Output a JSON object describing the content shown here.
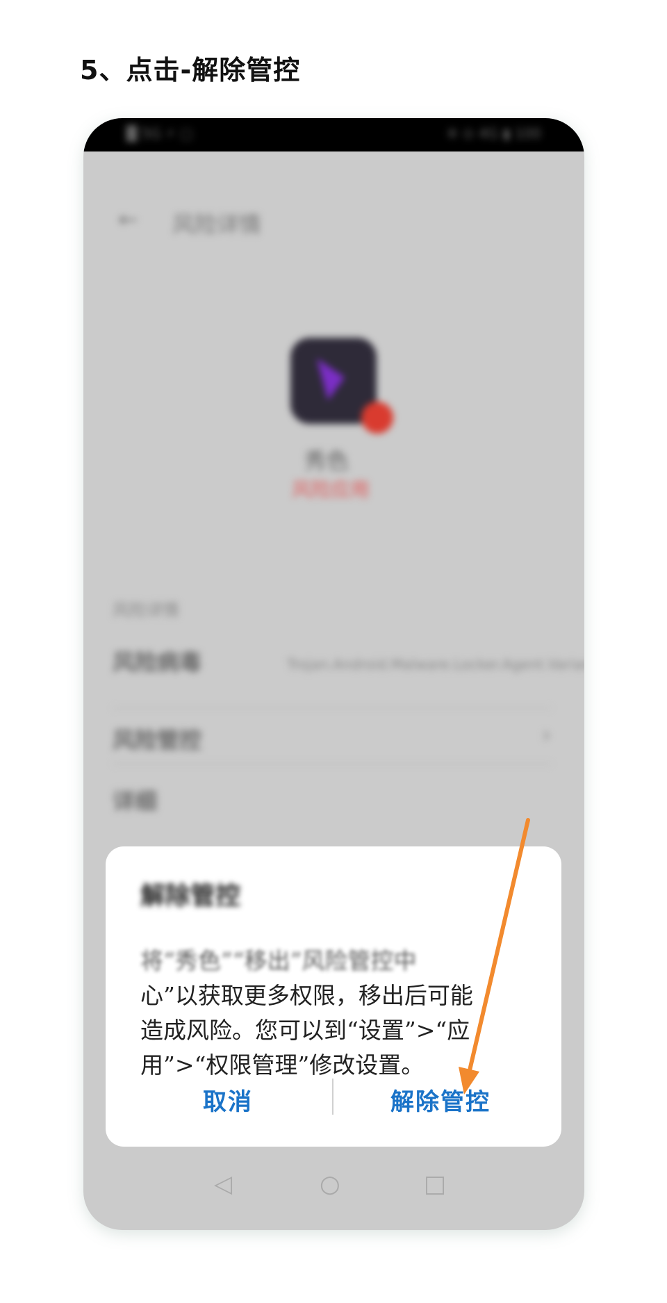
{
  "step_title": "5、点击-解除管控",
  "phone": {
    "status_bar": {
      "left": "█ 5G ⚡ ▢",
      "right": "※ ⊙ 4G ▮ 100"
    },
    "screen": {
      "title": "风险详情",
      "app_name": "秀色",
      "risk_status": "风险应用",
      "section_label": "风险详情",
      "rows": [
        {
          "label": "风险病毒",
          "value": "Trojan.Android.Malware.Locker.Agent.Variant.Lock"
        },
        {
          "label": "风险管控"
        },
        {
          "label": "详细"
        }
      ]
    },
    "dialog": {
      "title": "解除管控",
      "message_blurred": "将“秀色”“移出”风险管控中",
      "message_visible_1": "心”以获取更多权限，移出后可能",
      "message_visible_2": "造成风险。您可以到“设置”>“应",
      "message_visible_3": "用”>“权限管理”修改设置。",
      "cancel_label": "取消",
      "confirm_label": "解除管控"
    },
    "nav": {
      "back": "◁",
      "home": "○",
      "recent": "□"
    }
  },
  "colors": {
    "arrow": "#f28a2e",
    "dialog_button": "#1a73c8"
  },
  "icons": [
    "back-arrow-icon",
    "app-icon",
    "risk-badge-icon",
    "chevron-right-icon",
    "nav-back-icon",
    "nav-home-icon",
    "nav-recent-icon",
    "annotation-arrow-icon"
  ]
}
